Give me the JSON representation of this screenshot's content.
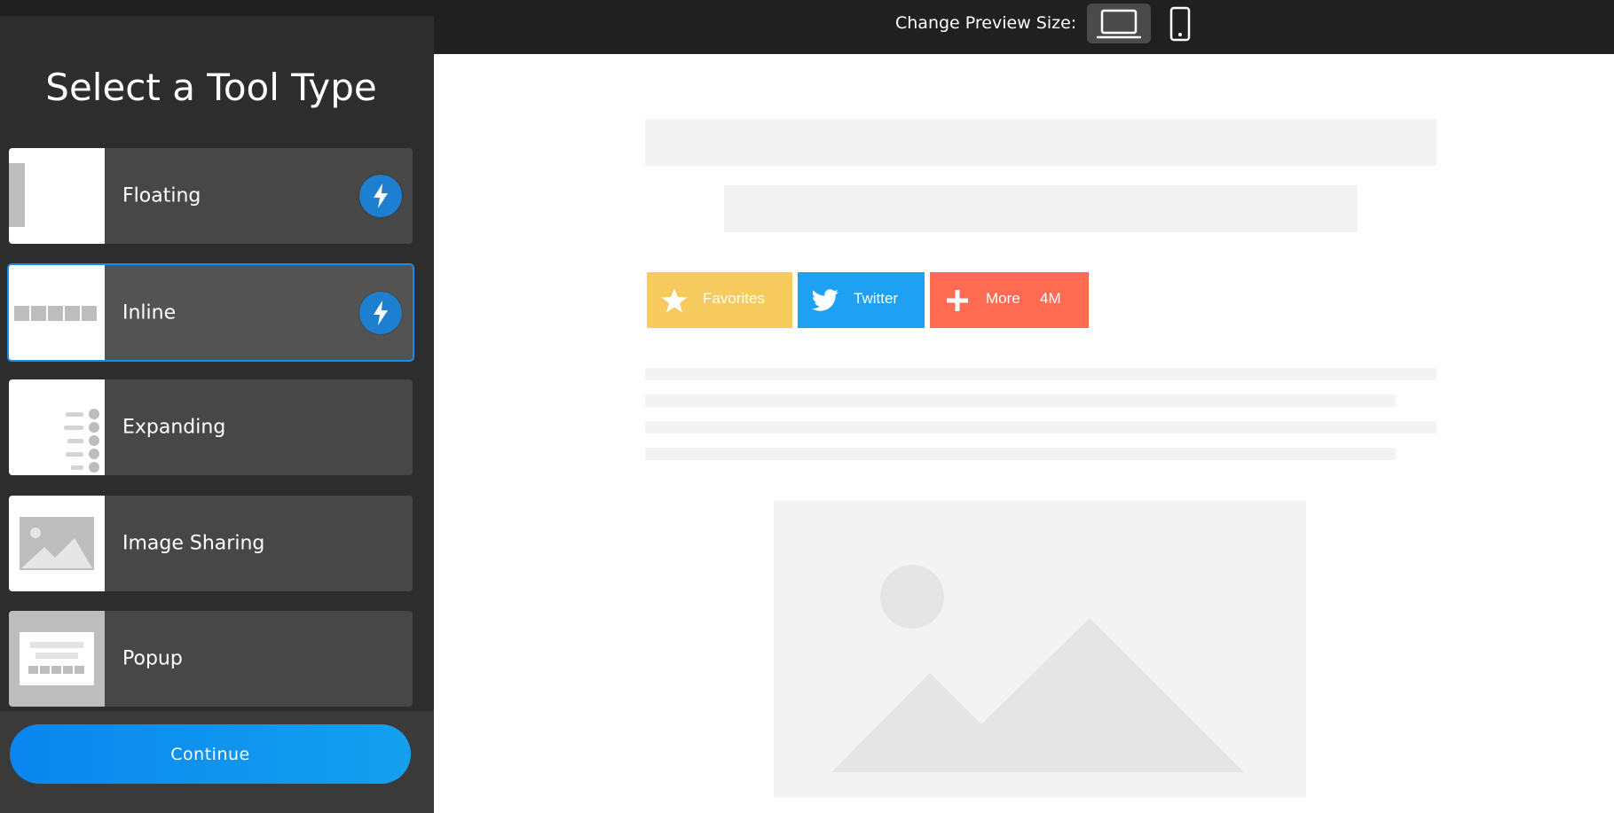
{
  "topbar": {
    "preview_label": "Change Preview Size:",
    "devices": [
      {
        "name": "desktop",
        "icon": "laptop-icon",
        "active": true
      },
      {
        "name": "mobile",
        "icon": "phone-icon",
        "active": false
      }
    ]
  },
  "sidebar": {
    "title": "Select a Tool Type",
    "tools": [
      {
        "label": "Floating",
        "icon": "floating-thumbnail",
        "badge": "bolt-icon",
        "selected": false
      },
      {
        "label": "Inline",
        "icon": "inline-thumbnail",
        "badge": "bolt-icon",
        "selected": true
      },
      {
        "label": "Expanding",
        "icon": "expanding-thumbnail",
        "badge": null,
        "selected": false
      },
      {
        "label": "Image Sharing",
        "icon": "image-sharing-thumbnail",
        "badge": null,
        "selected": false
      },
      {
        "label": "Popup",
        "icon": "popup-thumbnail",
        "badge": null,
        "selected": false
      }
    ],
    "continue_label": "Continue"
  },
  "preview": {
    "share_buttons": [
      {
        "label": "Favorites",
        "icon": "star-icon",
        "color": "#f6ca5d"
      },
      {
        "label": "Twitter",
        "icon": "twitter-bird-icon",
        "color": "#1ea1f2"
      },
      {
        "label": "More",
        "icon": "plus-icon",
        "count": "4M",
        "color": "#fe6a52"
      }
    ]
  },
  "colors": {
    "sidebar_bg": "#2d2d2d",
    "card_bg": "#474747",
    "selected_border": "#1e8ae8",
    "badge_blue": "#1e7fd1",
    "continue_blue": "#0a86ee"
  }
}
